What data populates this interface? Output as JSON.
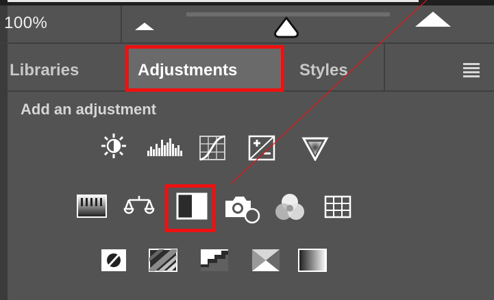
{
  "zoom": {
    "value": "100%"
  },
  "tabs": [
    {
      "label": "Libraries"
    },
    {
      "label": "Adjustments"
    },
    {
      "label": "Styles"
    }
  ],
  "panel": {
    "heading": "Add an adjustment"
  },
  "adjustments": {
    "row1": [
      "brightness-contrast-icon",
      "levels-icon",
      "curves-icon",
      "exposure-icon",
      "vibrance-icon"
    ],
    "row2": [
      "hue-saturation-icon",
      "color-balance-icon",
      "black-white-icon",
      "photo-filter-icon",
      "channel-mixer-icon",
      "color-lookup-icon"
    ],
    "row3": [
      "invert-icon",
      "posterize-icon",
      "threshold-icon",
      "selective-color-icon",
      "gradient-map-icon"
    ]
  },
  "colors": {
    "panel_bg": "#535353",
    "highlight": "#ee1111",
    "active_tab": "#6a6a6a"
  }
}
